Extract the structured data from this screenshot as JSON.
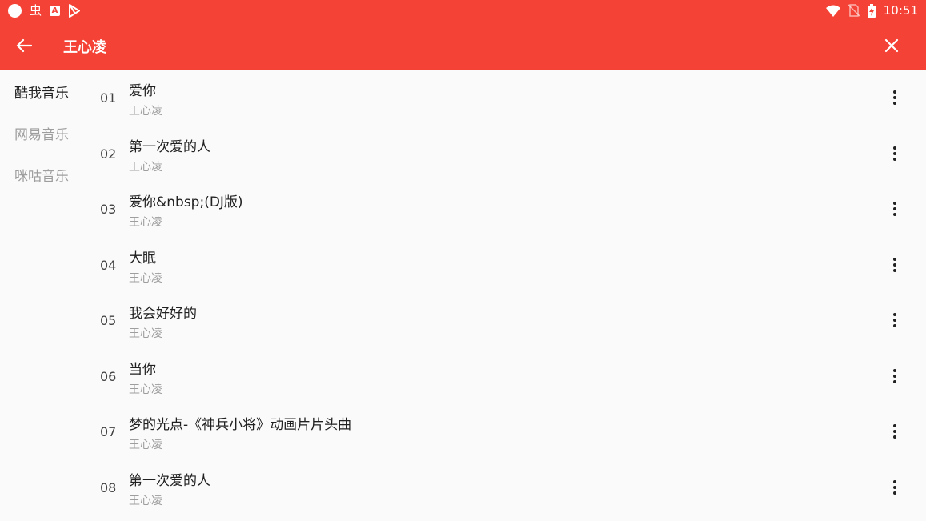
{
  "status": {
    "time": "10:51"
  },
  "header": {
    "title": "王心凌"
  },
  "sources": [
    {
      "label": "酷我音乐"
    },
    {
      "label": "网易音乐"
    },
    {
      "label": "咪咕音乐"
    }
  ],
  "songs": [
    {
      "num": "01",
      "name": "爱你",
      "artist": "王心凌"
    },
    {
      "num": "02",
      "name": "第一次爱的人",
      "artist": "王心凌"
    },
    {
      "num": "03",
      "name": "爱你&nbsp;(DJ版)",
      "artist": "王心凌"
    },
    {
      "num": "04",
      "name": "大眠",
      "artist": "王心凌"
    },
    {
      "num": "05",
      "name": "我会好好的",
      "artist": "王心凌"
    },
    {
      "num": "06",
      "name": "当你",
      "artist": "王心凌"
    },
    {
      "num": "07",
      "name": "梦的光点-《神兵小将》动画片片头曲",
      "artist": "王心凌"
    },
    {
      "num": "08",
      "name": "第一次爱的人",
      "artist": "王心凌"
    }
  ]
}
